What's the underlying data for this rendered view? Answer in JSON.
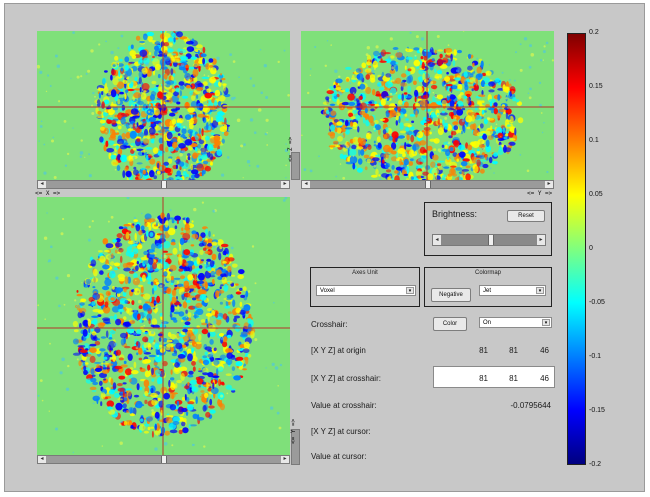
{
  "views": {
    "coronal_axis": "<= X =>",
    "sagittal_axis_bottom": "<= Y =>",
    "sagittal_axis_side": "<= Z =>",
    "axial_axis_side": "<= Y =>"
  },
  "brightness": {
    "label": "Brightness:",
    "reset_label": "Reset"
  },
  "axes_unit": {
    "title": "Axes Unit",
    "selected": "Voxel"
  },
  "colormap": {
    "title": "Colormap",
    "negative_label": "Negative",
    "selected": "Jet"
  },
  "crosshair": {
    "label": "Crosshair:",
    "color_label": "Color",
    "selected": "On"
  },
  "info": {
    "origin_label": "[X Y Z] at origin",
    "origin_values": [
      "81",
      "81",
      "46"
    ],
    "crosshair_label": "[X Y Z] at crosshair:",
    "crosshair_values": [
      "81",
      "81",
      "46"
    ],
    "value_crosshair_label": "Value at crosshair:",
    "value_crosshair": "-0.0795644",
    "cursor_label": "[X Y Z] at cursor:",
    "value_cursor_label": "Value at cursor:"
  },
  "colorbar": {
    "colormap": "jet",
    "min": -0.2,
    "max": 0.2,
    "ticks": [
      "0.2",
      "0.15",
      "0.1",
      "0.05",
      "0",
      "-0.05",
      "-0.1",
      "-0.15",
      "-0.2"
    ]
  },
  "colors": {
    "background_green": "#7fe07a",
    "crosshair": "#b5332a"
  }
}
